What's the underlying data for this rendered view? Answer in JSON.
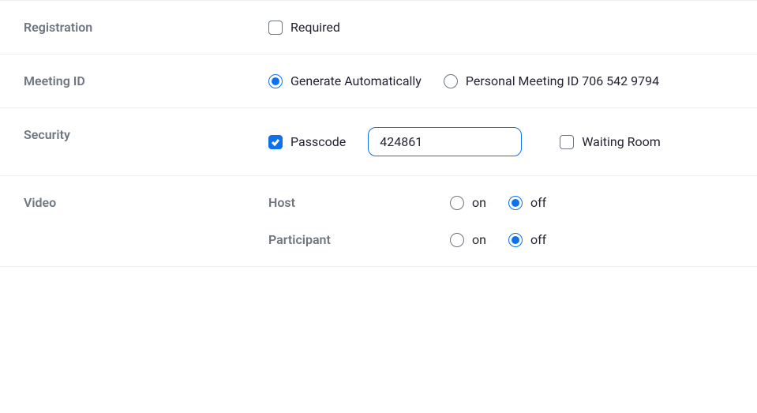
{
  "registration": {
    "label": "Registration",
    "required_label": "Required",
    "required_checked": false
  },
  "meeting_id": {
    "label": "Meeting ID",
    "auto_label": "Generate Automatically",
    "personal_label": "Personal Meeting ID 706 542 9794",
    "selected": "auto"
  },
  "security": {
    "label": "Security",
    "passcode_label": "Passcode",
    "passcode_checked": true,
    "passcode_value": "424861",
    "waiting_label": "Waiting Room",
    "waiting_checked": false
  },
  "video": {
    "label": "Video",
    "host_label": "Host",
    "participant_label": "Participant",
    "on_label": "on",
    "off_label": "off",
    "host_selected": "off",
    "participant_selected": "off"
  }
}
